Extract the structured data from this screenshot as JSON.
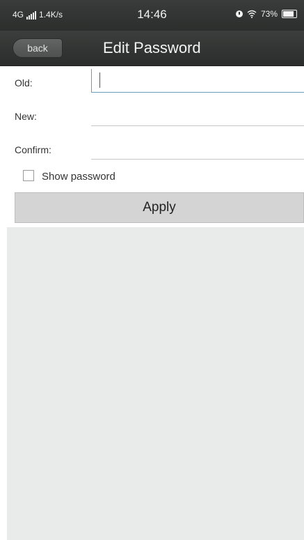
{
  "status_bar": {
    "network": "4G",
    "speed": "1.4K/s",
    "time": "14:46",
    "battery": "73%",
    "icons": [
      "signal-icon",
      "alarm-icon",
      "wifi-icon",
      "battery-icon"
    ]
  },
  "header": {
    "back_label": "back",
    "title": "Edit Password"
  },
  "form": {
    "old_label": "Old:",
    "old_value": "",
    "new_label": "New:",
    "new_value": "",
    "confirm_label": "Confirm:",
    "confirm_value": "",
    "show_password_label": "Show password",
    "show_password_checked": false,
    "apply_label": "Apply"
  },
  "colors": {
    "header_bg": "#333534",
    "focus_accent": "#6aa0b5",
    "button_bg": "#d4d4d4",
    "page_bg": "#e9ebea"
  }
}
